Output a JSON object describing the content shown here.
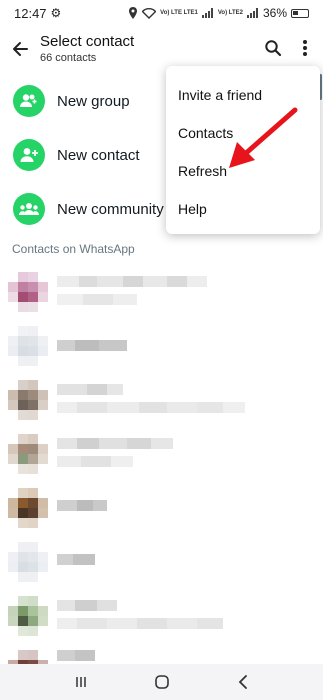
{
  "status_bar": {
    "time": "12:47",
    "battery": "36%",
    "network_a": "Vo) LTE LTE1",
    "network_b": "Vo) LTE2"
  },
  "header": {
    "title": "Select contact",
    "subtitle": "66 contacts"
  },
  "actions": [
    {
      "label": "New group",
      "icon": "add-group-icon"
    },
    {
      "label": "New contact",
      "icon": "add-person-icon"
    },
    {
      "label": "New community",
      "icon": "community-icon"
    }
  ],
  "section_header": "Contacts on WhatsApp",
  "menu": {
    "items": [
      {
        "label": "Invite a friend"
      },
      {
        "label": "Contacts"
      },
      {
        "label": "Refresh"
      },
      {
        "label": "Help"
      }
    ]
  },
  "colors": {
    "accent_green": "#25d366",
    "annotation_red": "#e8141b"
  }
}
